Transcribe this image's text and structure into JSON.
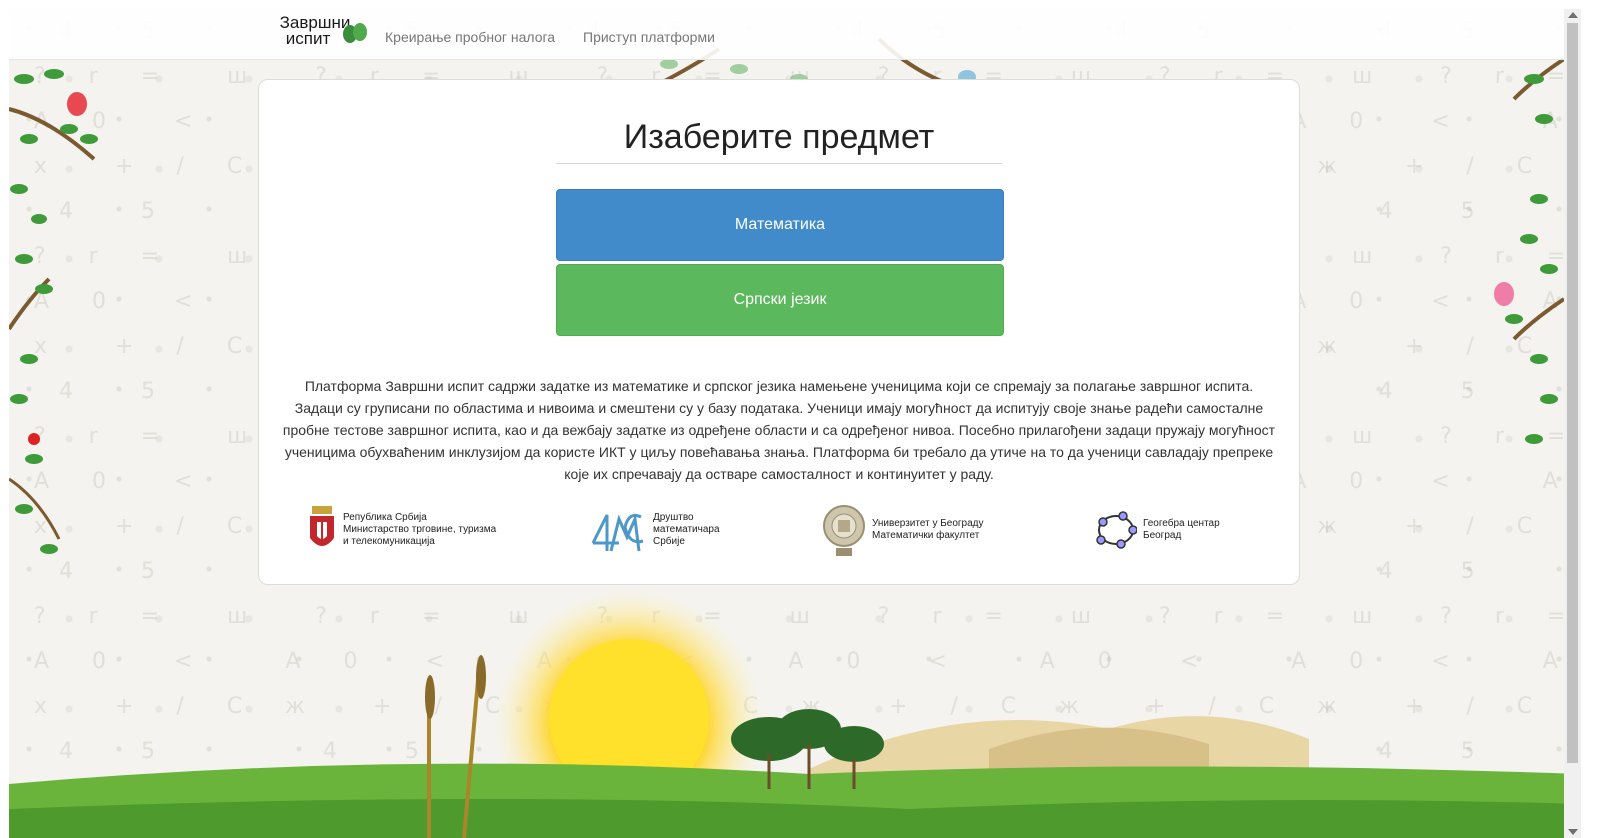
{
  "navbar": {
    "brand_line1": "Завршни",
    "brand_line2": "испит",
    "links": [
      "Креирање пробног налога",
      "Приступ платформи"
    ]
  },
  "main": {
    "title": "Изаберите предмет",
    "subjects": [
      "Математика",
      "Српски језик"
    ],
    "description": "Платформа Завршни испит садржи задатке из математике и српског језика намењене ученицима који се спремају за полагање завршног испита. Задаци су груписани по областима и нивоима и смештени су у базу података. Ученици имају могућност да испитују своје знање радећи самосталне пробне тестове завршног испита, као и да вежбају задатке из одређене области и са одређеног нивоа. Посебно прилагођени задаци пружају могућност ученицима обухваћеним инклузијом да користе ИКТ у циљу повећавања знања. Платформа би требало да утиче на то да ученици савладају препреке које их спречавају да остваре самосталност и континуитет у раду."
  },
  "partners": [
    {
      "text": "Република Србија\nМинистарство трговине, туризма\nи телекомуникација",
      "icon": "serbia-coat-of-arms-icon"
    },
    {
      "text": "Друштво\nматематичара\nСрбије",
      "icon": "dms-logo-icon"
    },
    {
      "text": "Универзитет у Београду\nМатематички факултет",
      "icon": "university-seal-icon"
    },
    {
      "text": "Геогебра центар\nБеоград",
      "icon": "geogebra-logo-icon"
    }
  ],
  "colors": {
    "math_button": "#428bca",
    "serbian_button": "#5cb85c",
    "grass": "#6ab43c",
    "sun": "#ffd21e"
  }
}
